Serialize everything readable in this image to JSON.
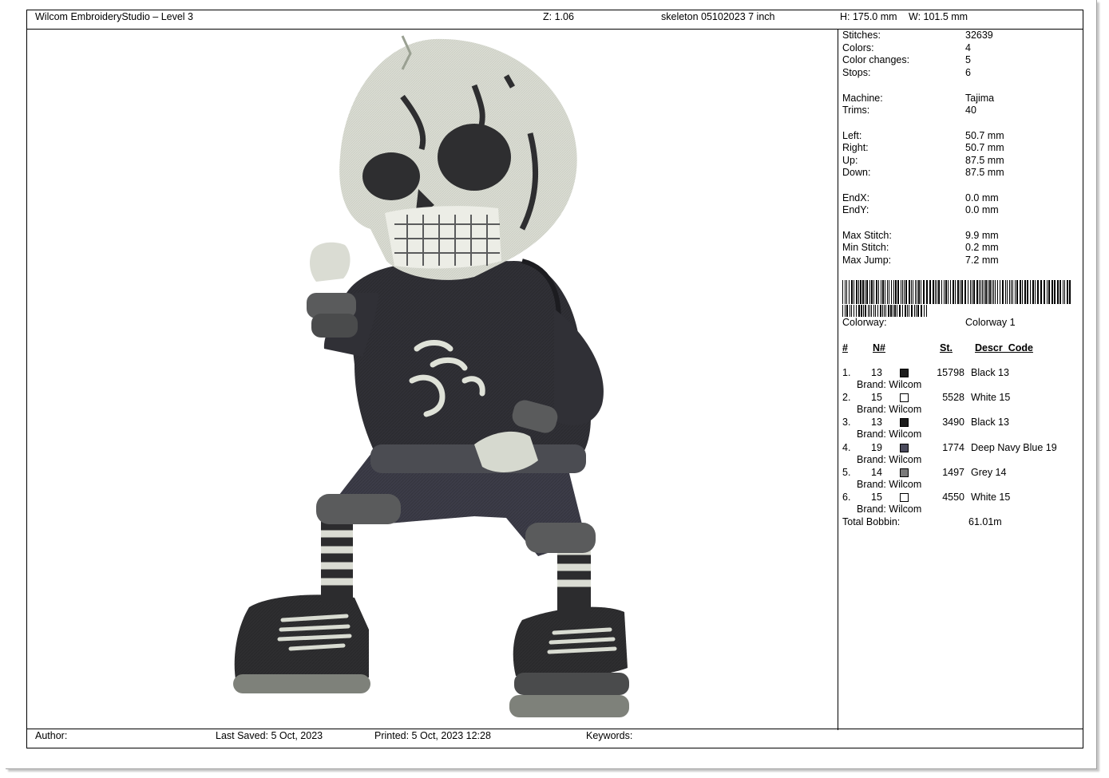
{
  "header": {
    "app_title": "Wilcom EmbroideryStudio – Level 3",
    "zoom": "Z: 1.06",
    "design_name": "skeleton 05102023 7 inch",
    "height": "H: 175.0 mm",
    "width": "W: 101.5 mm"
  },
  "stats": [
    {
      "label": "Stitches:",
      "value": "32639"
    },
    {
      "label": "Colors:",
      "value": "4"
    },
    {
      "label": "Color changes:",
      "value": "5"
    },
    {
      "label": "Stops:",
      "value": "6"
    },
    {
      "label": "Machine:",
      "value": "Tajima"
    },
    {
      "label": "Trims:",
      "value": "40"
    },
    {
      "label": "Left:",
      "value": "50.7 mm"
    },
    {
      "label": "Right:",
      "value": "50.7 mm"
    },
    {
      "label": "Up:",
      "value": "87.5 mm"
    },
    {
      "label": "Down:",
      "value": "87.5 mm"
    },
    {
      "label": "EndX:",
      "value": "0.0 mm"
    },
    {
      "label": "EndY:",
      "value": "0.0 mm"
    },
    {
      "label": "Max Stitch:",
      "value": "9.9 mm"
    },
    {
      "label": "Min Stitch:",
      "value": "0.2 mm"
    },
    {
      "label": "Max Jump:",
      "value": "7.2 mm"
    }
  ],
  "colorway": {
    "label": "Colorway:",
    "value": "Colorway 1"
  },
  "color_table": {
    "headers": [
      "#",
      "N#",
      "St.",
      "Descr_Code"
    ],
    "rows": [
      {
        "idx": "1.",
        "n": "13",
        "swatch": "#1c1c1c",
        "stitches": "15798",
        "descr": "Black 13",
        "brand": "Brand: Wilcom"
      },
      {
        "idx": "2.",
        "n": "15",
        "swatch": "#ffffff",
        "stitches": "5528",
        "descr": "White 15",
        "brand": "Brand: Wilcom"
      },
      {
        "idx": "3.",
        "n": "13",
        "swatch": "#1c1c1c",
        "stitches": "3490",
        "descr": "Black 13",
        "brand": "Brand: Wilcom"
      },
      {
        "idx": "4.",
        "n": "19",
        "swatch": "#4a4a5c",
        "stitches": "1774",
        "descr": "Deep Navy Blue 19",
        "brand": "Brand: Wilcom"
      },
      {
        "idx": "5.",
        "n": "14",
        "swatch": "#7a7a7a",
        "stitches": "1497",
        "descr": "Grey 14",
        "brand": "Brand: Wilcom"
      },
      {
        "idx": "6.",
        "n": "15",
        "swatch": "#ffffff",
        "stitches": "4550",
        "descr": "White 15",
        "brand": "Brand: Wilcom"
      }
    ],
    "total_label": "Total Bobbin:",
    "total_value": "61.01m"
  },
  "footer": {
    "author_label": "Author:",
    "last_saved": "Last Saved:  5 Oct, 2023",
    "printed": "Printed:  5 Oct, 2023 12:28",
    "keywords_label": "Keywords:"
  },
  "colors": {
    "thread_black": "#2a2a2c",
    "thread_white": "#e6e8df",
    "thread_navy": "#4a4a5c",
    "thread_grey": "#7a7a7a"
  }
}
